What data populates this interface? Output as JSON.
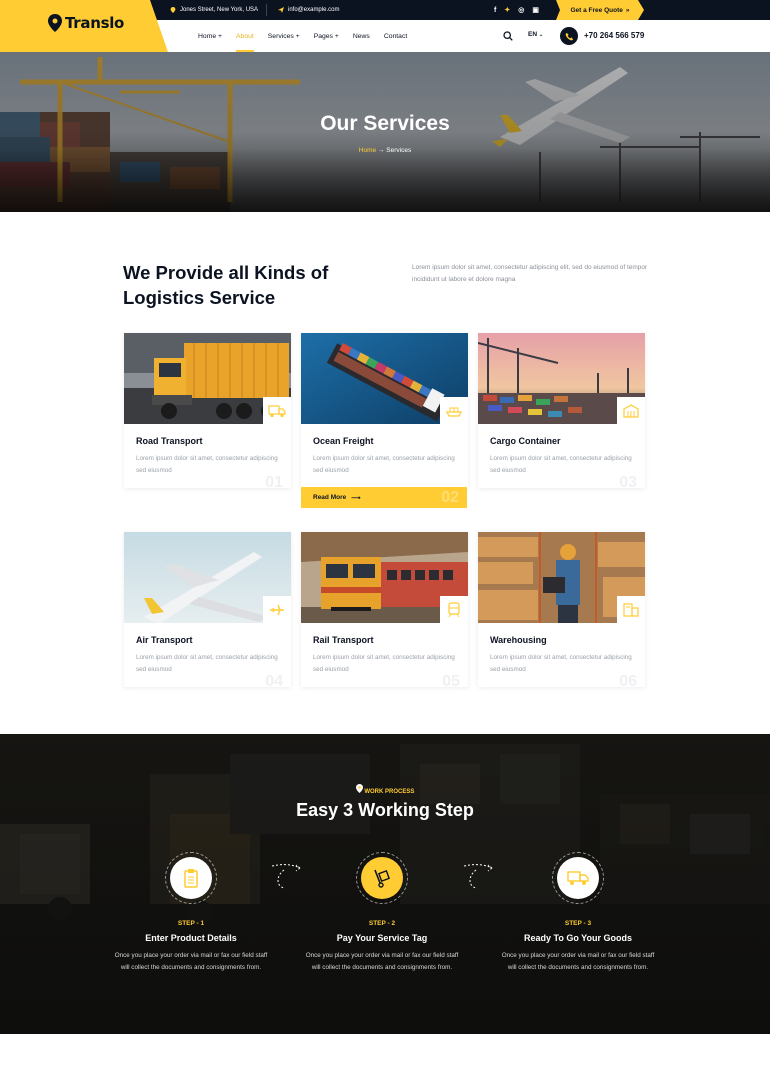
{
  "brand": {
    "name": "Translo",
    "accent": "#ffcc33",
    "dark": "#0b1220"
  },
  "topbar": {
    "address": "Jones Street, New York, USA",
    "email": "info@example.com",
    "social": [
      "f",
      "t",
      "ig",
      "in"
    ],
    "quote_label": "Get a Free Quote",
    "quote_icon": "double-chevron-right-icon"
  },
  "nav": {
    "items": [
      {
        "label": "Home +",
        "active": false
      },
      {
        "label": "About",
        "active": true
      },
      {
        "label": "Services +",
        "active": false
      },
      {
        "label": "Pages +",
        "active": false
      },
      {
        "label": "News",
        "active": false
      },
      {
        "label": "Contact",
        "active": false
      }
    ],
    "language": "EN",
    "phone": "+70 264 566 579"
  },
  "hero": {
    "title": "Our Services",
    "breadcrumb_home": "Home",
    "breadcrumb_sep": "→",
    "breadcrumb_current": "Services"
  },
  "services": {
    "title": "We Provide all Kinds of Logistics Service",
    "description": "Lorem ipsum dolor sit amet, consectetur adipiscing elit, sed do eiusmod of tempor incididunt ut labore et dolore magna",
    "cta_label": "Read More",
    "items": [
      {
        "title": "Road Transport",
        "desc": "Lorem ipsum dolor sit amet, consectetur adipiscing sed eiusmod",
        "num": "01",
        "icon": "truck-icon"
      },
      {
        "title": "Ocean Freight",
        "desc": "Lorem ipsum dolor sit amet, consectetur adipiscing sed eiusmod",
        "num": "02",
        "icon": "ship-icon"
      },
      {
        "title": "Cargo Container",
        "desc": "Lorem ipsum dolor sit amet, consectetur adipiscing sed eiusmod",
        "num": "03",
        "icon": "warehouse-icon"
      },
      {
        "title": "Air Transport",
        "desc": "Lorem ipsum dolor sit amet, consectetur adipiscing sed eiusmod",
        "num": "04",
        "icon": "plane-icon"
      },
      {
        "title": "Rail Transport",
        "desc": "Lorem ipsum dolor sit amet, consectetur adipiscing sed eiusmod",
        "num": "05",
        "icon": "train-icon"
      },
      {
        "title": "Warehousing",
        "desc": "Lorem ipsum dolor sit amet, consectetur adipiscing sed eiusmod",
        "num": "06",
        "icon": "boxes-icon"
      }
    ]
  },
  "work": {
    "tag": "WORK PROCESS",
    "title": "Easy 3 Working Step",
    "steps": [
      {
        "label": "STEP - 1",
        "title": "Enter Product Details",
        "desc": "Once you place your order via mail or fax our field staff will collect the documents and consignments from.",
        "icon": "clipboard-icon"
      },
      {
        "label": "STEP - 2",
        "title": "Pay Your Service Tag",
        "desc": "Once you place your order via mail or fax our field staff will collect the documents and consignments from.",
        "icon": "hand-truck-icon"
      },
      {
        "label": "STEP - 3",
        "title": "Ready To Go Your Goods",
        "desc": "Once you place your order via mail or fax our field staff will collect the documents and consignments from.",
        "icon": "delivery-truck-icon"
      }
    ]
  }
}
